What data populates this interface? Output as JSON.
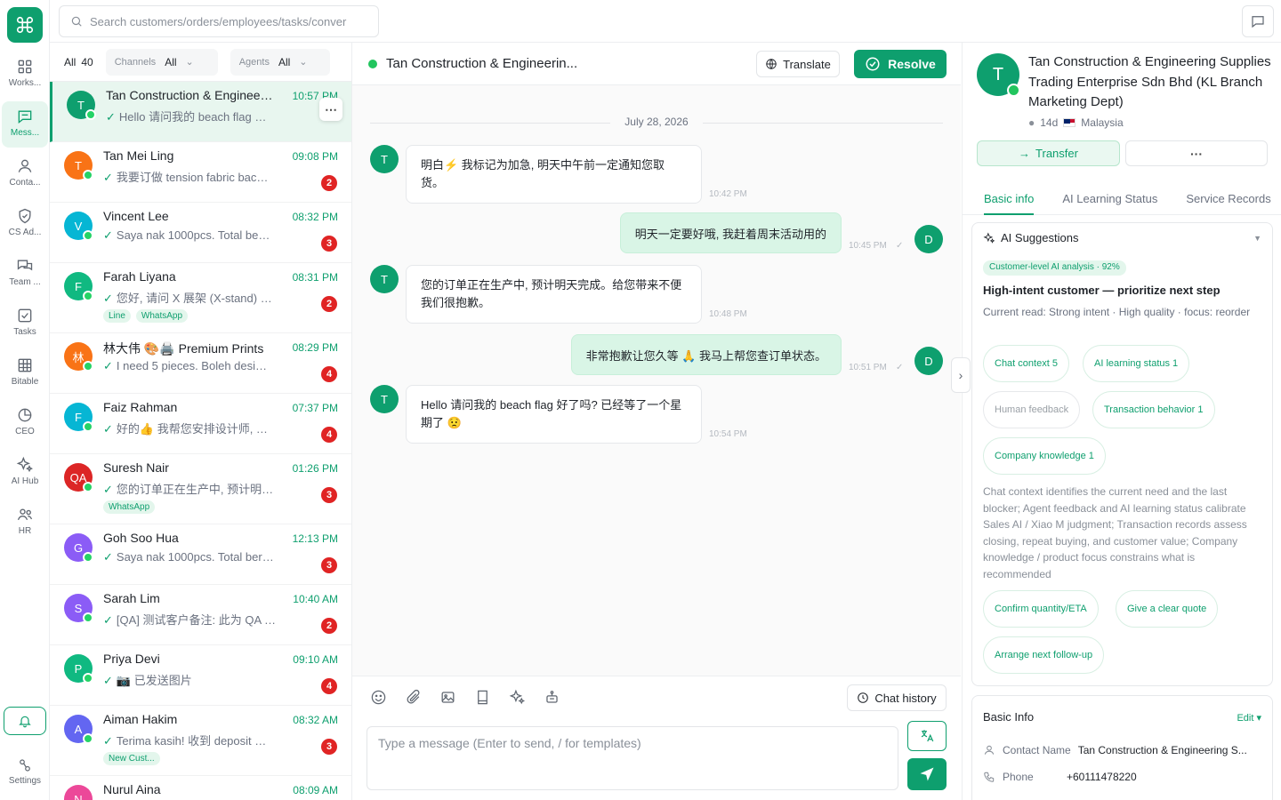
{
  "search": {
    "placeholder": "Search customers/orders/employees/tasks/conver"
  },
  "nav": [
    {
      "label": "Works...",
      "icon": "grid-icon"
    },
    {
      "label": "Mess...",
      "icon": "message-icon",
      "active": true
    },
    {
      "label": "Conta...",
      "icon": "contacts-icon"
    },
    {
      "label": "CS Ad...",
      "icon": "shield-icon"
    },
    {
      "label": "Team ...",
      "icon": "team-chat-icon"
    },
    {
      "label": "Tasks",
      "icon": "task-icon"
    },
    {
      "label": "Bitable",
      "icon": "table-icon"
    },
    {
      "label": "CEO",
      "icon": "pie-icon"
    },
    {
      "label": "AI Hub",
      "icon": "sparkle-icon"
    },
    {
      "label": "HR",
      "icon": "people-icon"
    }
  ],
  "settings_label": "Settings",
  "filters": {
    "all_label": "All",
    "all_count": "40",
    "channels_label": "Channels",
    "channels_value": "All",
    "agents_label": "Agents",
    "agents_value": "All"
  },
  "conversations": [
    {
      "initial": "T",
      "color": "#0e9f6e",
      "name": "Tan Construction & Enginee…",
      "time": "10:57 PM",
      "preview": "Hello 请问我的 beach flag …",
      "badge": "",
      "tags": []
    },
    {
      "initial": "T",
      "color": "#f97316",
      "name": "Tan Mei Ling",
      "time": "09:08 PM",
      "preview": "我要订做 tension fabric bac…",
      "badge": "2",
      "tags": []
    },
    {
      "initial": "V",
      "color": "#06b6d4",
      "name": "Vincent Lee",
      "time": "08:32 PM",
      "preview": "Saya nak 1000pcs. Total be…",
      "badge": "3",
      "tags": []
    },
    {
      "initial": "F",
      "color": "#10b981",
      "name": "Farah Liyana",
      "time": "08:31 PM",
      "preview": "您好, 请问 X 展架 (X-stand) …",
      "badge": "2",
      "tags": [
        "Line",
        "WhatsApp"
      ]
    },
    {
      "initial": "林",
      "color": "#f97316",
      "name": "林大伟 🎨🖨️ Premium Prints",
      "time": "08:29 PM",
      "preview": "I need 5 pieces. Boleh desi…",
      "badge": "4",
      "tags": []
    },
    {
      "initial": "F",
      "color": "#06b6d4",
      "name": "Faiz Rahman",
      "time": "07:37 PM",
      "preview": "好的👍 我帮您安排设计师, …",
      "badge": "4",
      "tags": []
    },
    {
      "initial": "QA",
      "color": "#dc2626",
      "name": "Suresh Nair",
      "time": "01:26 PM",
      "preview": "您的订单正在生产中, 预计明…",
      "badge": "3",
      "tags": [
        "WhatsApp"
      ]
    },
    {
      "initial": "G",
      "color": "#8b5cf6",
      "name": "Goh Soo Hua",
      "time": "12:13 PM",
      "preview": "Saya nak 1000pcs. Total ber…",
      "badge": "3",
      "tags": []
    },
    {
      "initial": "S",
      "color": "#8b5cf6",
      "name": "Sarah Lim",
      "time": "10:40 AM",
      "preview": "[QA] 测试客户备注: 此为 QA 种…",
      "badge": "2",
      "tags": []
    },
    {
      "initial": "P",
      "color": "#10b981",
      "name": "Priya Devi",
      "time": "09:10 AM",
      "preview": "📷 已发送图片",
      "badge": "4",
      "tags": []
    },
    {
      "initial": "A",
      "color": "#6366f1",
      "name": "Aiman Hakim",
      "time": "08:32 AM",
      "preview": "Terima kasih! 收到 deposit …",
      "badge": "3",
      "tags": [
        "New Cust..."
      ]
    },
    {
      "initial": "N",
      "color": "#ec4899",
      "name": "Nurul Aina",
      "time": "08:09 AM",
      "preview": "",
      "badge": "",
      "tags": []
    }
  ],
  "chat": {
    "title": "Tan Construction & Engineerin...",
    "translate_label": "Translate",
    "resolve_label": "Resolve",
    "date": "July 28, 2026",
    "messages": [
      {
        "dir": "in",
        "avatar": "T",
        "text": "明白⚡ 我标记为加急, 明天中午前一定通知您取货。",
        "time": "10:42 PM"
      },
      {
        "dir": "out",
        "avatar": "D",
        "text": "明天一定要好哦, 我赶着周末活动用的",
        "time": "10:45 PM"
      },
      {
        "dir": "in",
        "avatar": "T",
        "text": "您的订单正在生产中, 预计明天完成。给您带来不便我们很抱歉。",
        "time": "10:48 PM"
      },
      {
        "dir": "out",
        "avatar": "D",
        "text": "非常抱歉让您久等 🙏 我马上帮您查订单状态。",
        "time": "10:51 PM"
      },
      {
        "dir": "in",
        "avatar": "T",
        "text": "Hello 请问我的 beach flag 好了吗? 已经等了一个星期了 😟",
        "time": "10:54 PM"
      }
    ],
    "history_label": "Chat history",
    "input_placeholder": "Type a message (Enter to send, / for templates)"
  },
  "profile": {
    "initial": "T",
    "name": "Tan Construction & Engineering Supplies Trading Enterprise Sdn Bhd (KL Branch Marketing Dept)",
    "age": "14d",
    "country": "Malaysia",
    "transfer_label": "Transfer",
    "more_label": "···",
    "tabs": [
      "Basic info",
      "AI Learning Status",
      "Service Records"
    ]
  },
  "ai": {
    "header": "AI Suggestions",
    "pill": "Customer-level AI analysis · 92%",
    "title": "High-intent customer — prioritize next step",
    "subtitle": "Current read: Strong intent · High quality · focus: reorder",
    "chips": [
      "Chat context 5",
      "AI learning status 1",
      "Human feedback",
      "Transaction behavior 1",
      "Company knowledge 1"
    ],
    "paragraph": "Chat context identifies the current need and the last blocker; Agent feedback and AI learning status calibrate Sales AI / Xiao M judgment; Transaction records assess closing, repeat buying, and customer value; Company knowledge / product focus constrains what is recommended",
    "actions": [
      "Confirm quantity/ETA",
      "Give a clear quote",
      "Arrange next follow-up"
    ]
  },
  "basic_info": {
    "header": "Basic Info",
    "edit_label": "Edit",
    "contact_label": "Contact Name",
    "contact_value": "Tan Construction & Engineering S...",
    "phone_label": "Phone",
    "phone_value": "+60111478220"
  },
  "colors": {
    "accent": "#0e9f6e",
    "badge": "#e02424",
    "bubble_out": "#d9f5e6"
  }
}
